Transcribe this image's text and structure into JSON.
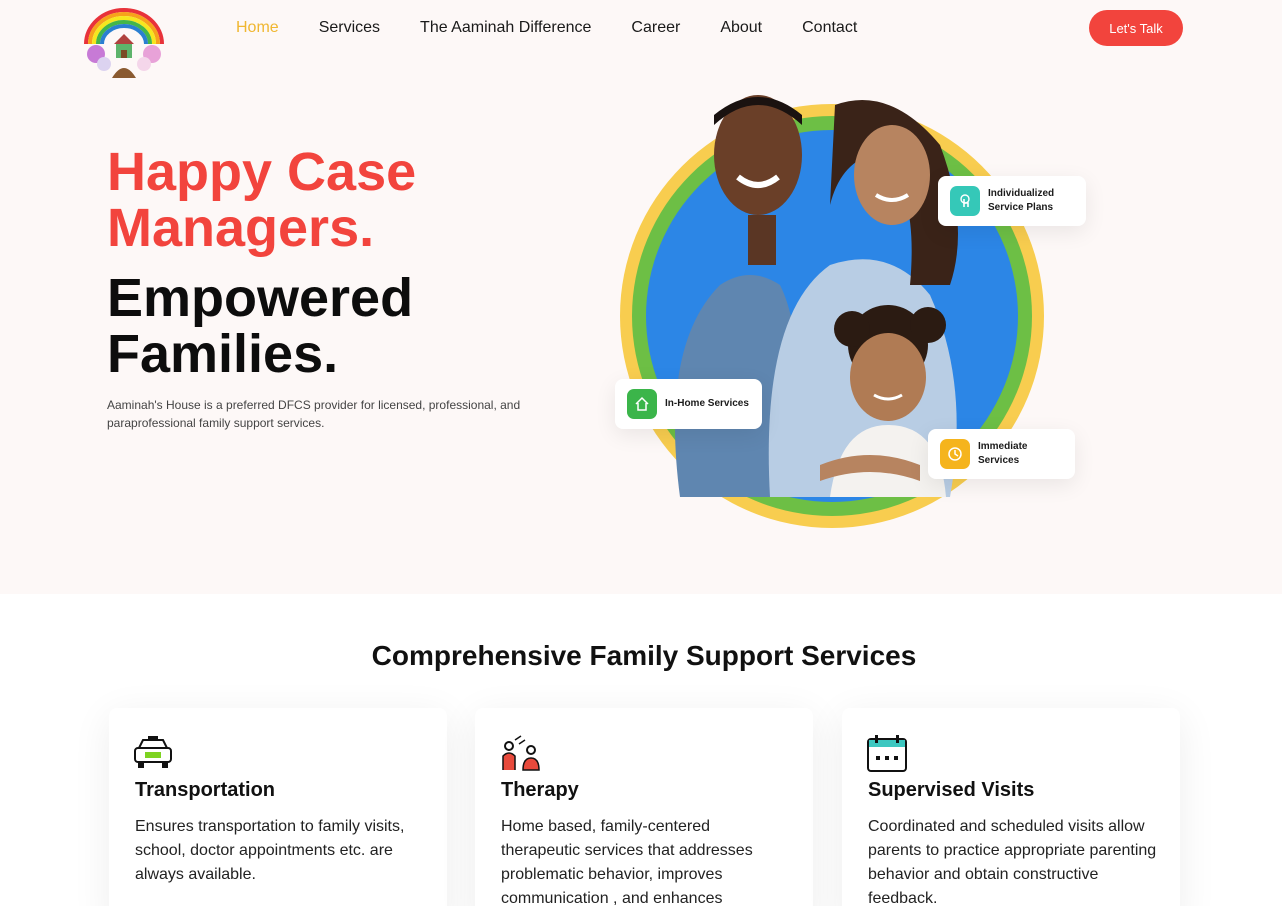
{
  "header": {
    "logo_name": "aaminahs-house-logo",
    "nav": [
      {
        "label": "Home",
        "active": true
      },
      {
        "label": "Services",
        "active": false
      },
      {
        "label": "The Aaminah Difference",
        "active": false
      },
      {
        "label": "Career",
        "active": false
      },
      {
        "label": "About",
        "active": false
      },
      {
        "label": "Contact",
        "active": false
      }
    ],
    "cta_label": "Let's Talk"
  },
  "hero": {
    "headline_red": "Happy Case Managers.",
    "headline_black": "Empowered Families.",
    "description": "Aaminah's House is a preferred DFCS provider for licensed, professional, and paraprofessional family support services.",
    "badges": [
      {
        "label": "Individualized Service Plans",
        "icon": "hand-tap-icon",
        "color": "#35c8b8"
      },
      {
        "label": "In-Home Services",
        "icon": "home-icon",
        "color": "#3bb54a"
      },
      {
        "label": "Immediate Services",
        "icon": "clock-icon",
        "color": "#f5b41d"
      }
    ],
    "ring_colors": [
      "#f8cd4f",
      "#6dbf45",
      "#2c86e6"
    ]
  },
  "services": {
    "title": "Comprehensive Family Support Services",
    "cards": [
      {
        "icon": "taxi-icon",
        "title": "Transportation",
        "text": "Ensures transportation to family visits, school, doctor appointments etc. are always available."
      },
      {
        "icon": "therapy-icon",
        "title": "Therapy",
        "text": "Home based, family-centered therapeutic services that addresses problematic behavior, improves communication , and enhances"
      },
      {
        "icon": "calendar-icon",
        "title": "Supervised Visits",
        "text": "Coordinated and scheduled visits allow parents to practice appropriate parenting behavior and obtain constructive feedback."
      }
    ]
  },
  "colors": {
    "accent_red": "#f2443d",
    "nav_active": "#f0b731",
    "hero_bg": "#fdf8f7"
  }
}
